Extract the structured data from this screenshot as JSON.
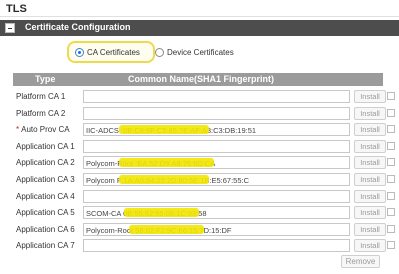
{
  "page": {
    "title": "TLS"
  },
  "section": {
    "title": "Certificate Configuration"
  },
  "radios": {
    "ca_label": "CA Certificates",
    "device_label": "Device Certificates",
    "selected": "ca"
  },
  "table": {
    "headers": {
      "type": "Type",
      "common_name": "Common Name(SHA1 Fingerprint)"
    },
    "install_label": "Install",
    "rows": [
      {
        "type": "Platform CA 1",
        "required": false,
        "value_visible": ""
      },
      {
        "type": "Platform CA 2",
        "required": false,
        "value_visible": ""
      },
      {
        "type": "Auto Prov CA",
        "required": true,
        "value_visible": "IIC-ADCS                  :0B:C8:6F:C5:85:7E:AF:A3:C3:DB:19:51"
      },
      {
        "type": "Application CA 1",
        "required": false,
        "value_visible": ""
      },
      {
        "type": "Application CA 2",
        "required": false,
        "value_visible": "Polycom-Root             :EA:52:D9:A8:76:6D:CA"
      },
      {
        "type": "Application CA 3",
        "required": false,
        "value_visible": "Polycom                  F:1A:A0:84:25:2D:80:5E:1B:E5:67:55:C"
      },
      {
        "type": "Application CA 4",
        "required": false,
        "value_visible": ""
      },
      {
        "type": "Application CA 5",
        "required": false,
        "value_visible": "SCOM-CA                  0B:55:82:55:08:1C:93:58"
      },
      {
        "type": "Application CA 6",
        "required": false,
        "value_visible": "Polycom-Root             58:02:F2:9C:66:15:7D:15:DF"
      },
      {
        "type": "Application CA 7",
        "required": false,
        "value_visible": ""
      }
    ]
  },
  "remove_label": "Remove",
  "colors": {
    "section_bar": "#4d4d4d",
    "table_header": "#9b9b9b",
    "highlight_outline": "#ecdc4c",
    "redaction": "#f2e600",
    "required_marker": "#d02020"
  }
}
